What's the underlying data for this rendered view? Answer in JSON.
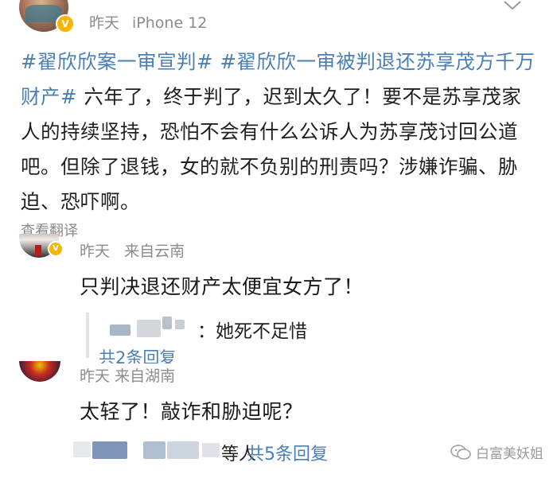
{
  "post": {
    "author": {
      "time": "昨天",
      "device": "iPhone 12",
      "verified_badge": "V"
    },
    "hashtags": [
      "#翟欣欣案一审宣判#",
      "#翟欣欣一审被判退还苏享茂方千万财产#"
    ],
    "body": "六年了，终于判了，迟到太久了！要不是苏享茂家人的持续坚持，恐怕不会有什么公诉人为苏享茂讨回公道吧。但除了退钱，女的就不负别的刑责吗？涉嫌诈骗、胁迫、恐吓啊。",
    "translate_label": "查看翻译",
    "more_icon": "chevron-down-icon"
  },
  "comments": [
    {
      "time": "昨天",
      "location": "来自云南",
      "text": "只判决退还财产太便宜女方了！",
      "reply_preview": {
        "text": "：她死不足惜",
        "count_label": "共2条回复"
      }
    },
    {
      "time": "昨天",
      "location": "来自湖南",
      "text": "太轻了！敲诈和胁迫呢？",
      "reply_summary": {
        "suffix": "等人",
        "count_label": "共5条回复"
      }
    }
  ],
  "watermark": {
    "text": "白富美妖姐",
    "icon": "wechat-icon"
  },
  "colors": {
    "link_blue": "#4a7fb5",
    "meta_gray": "#8c8c8c",
    "verified_gold": "#f7b500"
  }
}
